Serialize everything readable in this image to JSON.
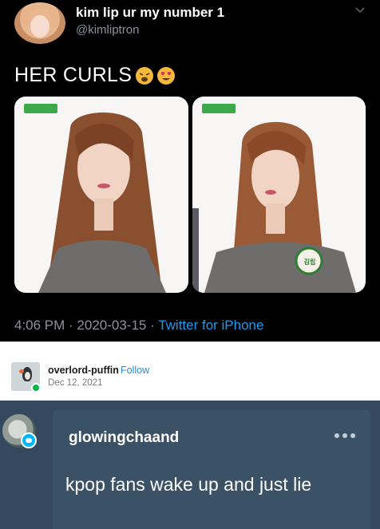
{
  "tweet": {
    "display_name": "kim lip ur my number 1",
    "handle": "@kimliptron",
    "text": "HER CURLS",
    "emojis": [
      "weary-face-emoji",
      "heart-eyes-emoji"
    ],
    "timestamp": "4:06 PM · 2020-03-15 · ",
    "client": "Twitter for iPhone",
    "photo_badge_text": "김립",
    "colors": {
      "background": "#000000",
      "link": "#1d9bf0",
      "meta": "#8e9297"
    }
  },
  "tumblr_post": {
    "username": "overlord-puffin",
    "follow_label": "Follow",
    "date": "Dec 12, 2021"
  },
  "reblog": {
    "username": "glowingchaand",
    "text": "kpop fans wake up and just lie",
    "colors": {
      "background": "#34495e",
      "card": "#3b5266"
    }
  }
}
